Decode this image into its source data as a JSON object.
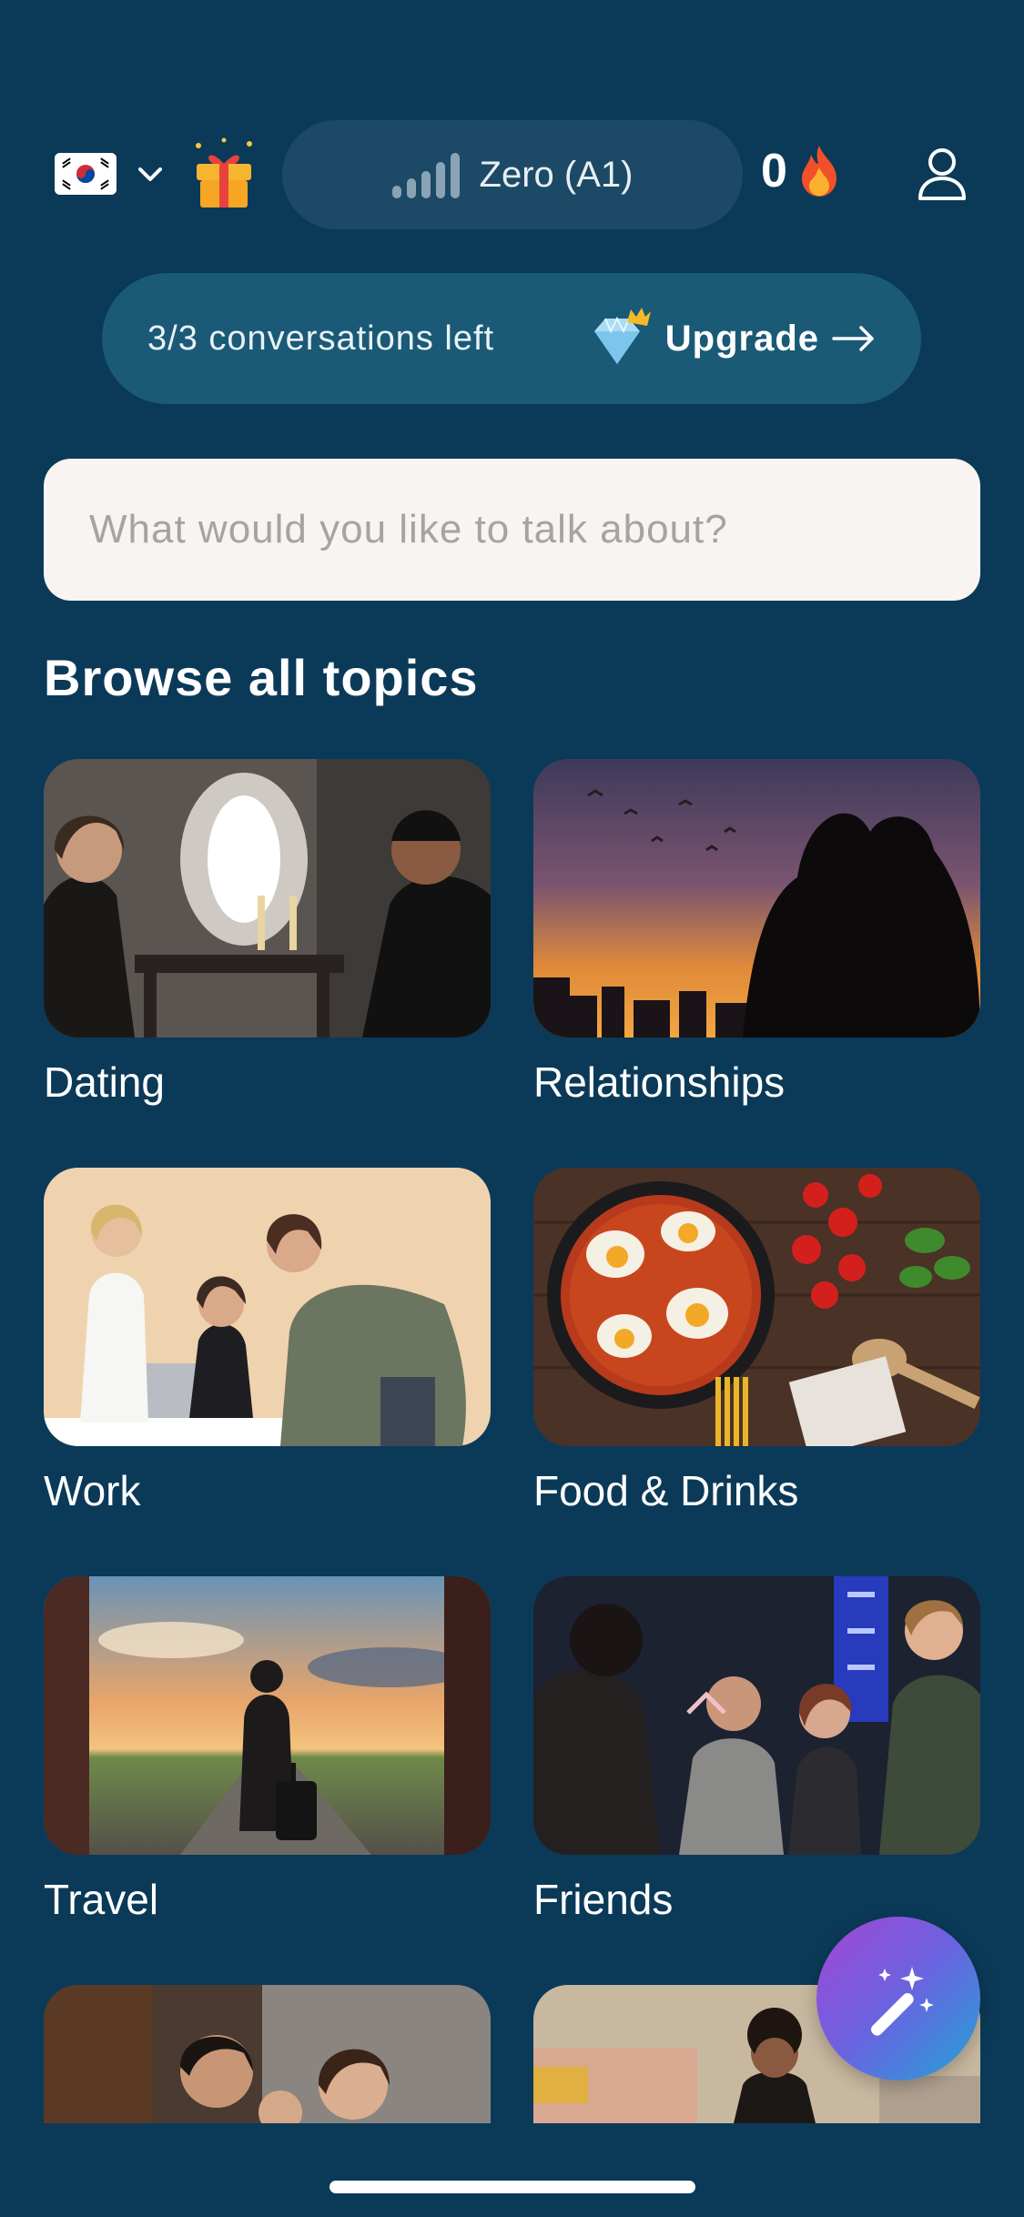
{
  "header": {
    "language_flag": "south-korea-flag",
    "level_label": "Zero (A1)",
    "streak_count": "0",
    "icons": {
      "gift": "gift-icon",
      "signal": "signal-bars-icon",
      "flame": "flame-icon",
      "profile": "user-icon"
    }
  },
  "upgrade_banner": {
    "conversations_left": "3/3 conversations left",
    "upgrade_label": "Upgrade"
  },
  "search": {
    "placeholder": "What would you like to talk about?",
    "value": ""
  },
  "browse": {
    "title": "Browse all topics",
    "topics": [
      {
        "label": "Dating"
      },
      {
        "label": "Relationships"
      },
      {
        "label": "Work"
      },
      {
        "label": "Food & Drinks"
      },
      {
        "label": "Travel"
      },
      {
        "label": "Friends"
      },
      {
        "label": ""
      },
      {
        "label": ""
      }
    ]
  },
  "colors": {
    "background": "#0b3a58",
    "pill": "#1c4a66",
    "banner": "#1a5a76",
    "search_bg": "#f8f4f2"
  }
}
